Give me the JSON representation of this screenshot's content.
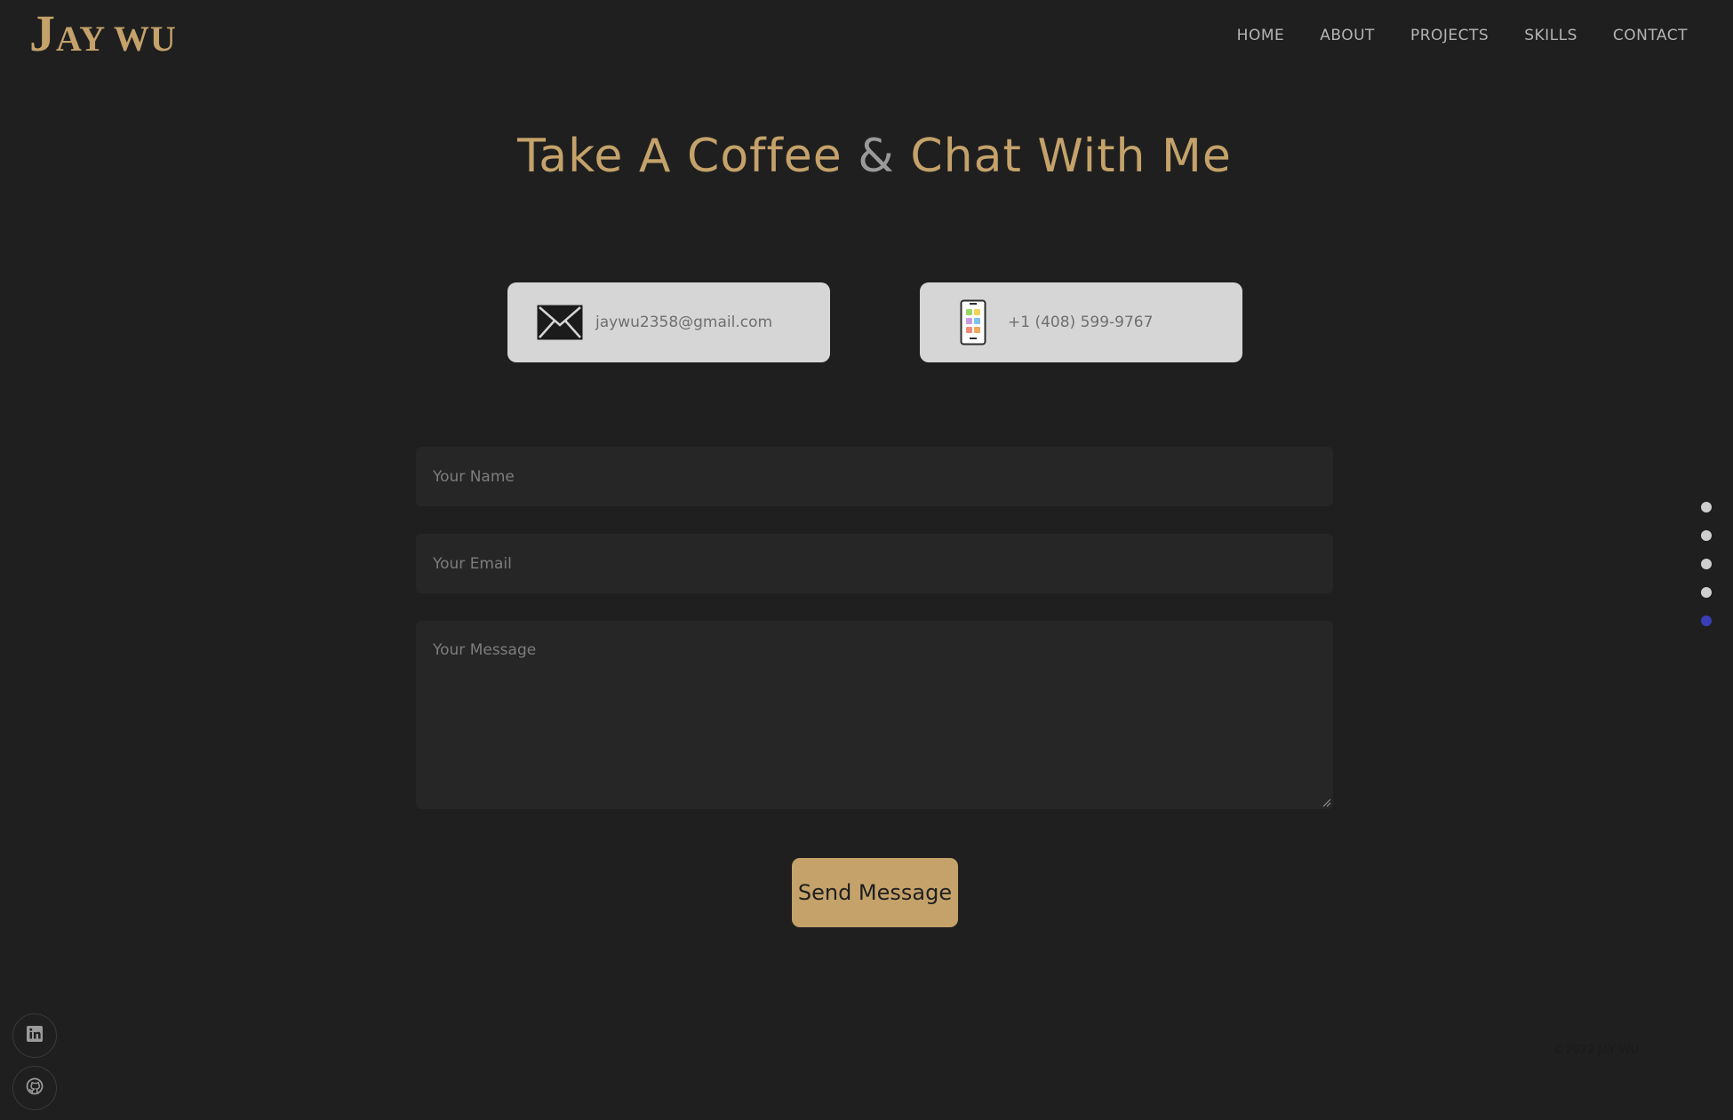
{
  "header": {
    "logo_initial": "J",
    "logo_rest": "AY WU",
    "nav": [
      "HOME",
      "ABOUT",
      "PROJECTS",
      "SKILLS",
      "CONTACT"
    ]
  },
  "title": {
    "part1": "Take A Coffee",
    "amp": "&",
    "part2": "Chat With Me"
  },
  "contact": {
    "email": "jaywu2358@gmail.com",
    "email_icon": "envelope-icon",
    "phone": "+1 (408) 599-9767",
    "phone_icon": "smartphone-icon"
  },
  "form": {
    "name_placeholder": "Your Name",
    "email_placeholder": "Your Email",
    "message_placeholder": "Your Message",
    "send_label": "Send Message"
  },
  "section_dots": {
    "count": 5,
    "active_index": 4,
    "active_color": "#3a3fb8"
  },
  "social": [
    "linkedin-icon",
    "github-icon"
  ],
  "footer": {
    "copyright": "©2022 JAY WU"
  },
  "colors": {
    "background": "#1f1f1f",
    "accent": "#c4a26a",
    "card": "#d6d6d6",
    "field": "#262626"
  }
}
